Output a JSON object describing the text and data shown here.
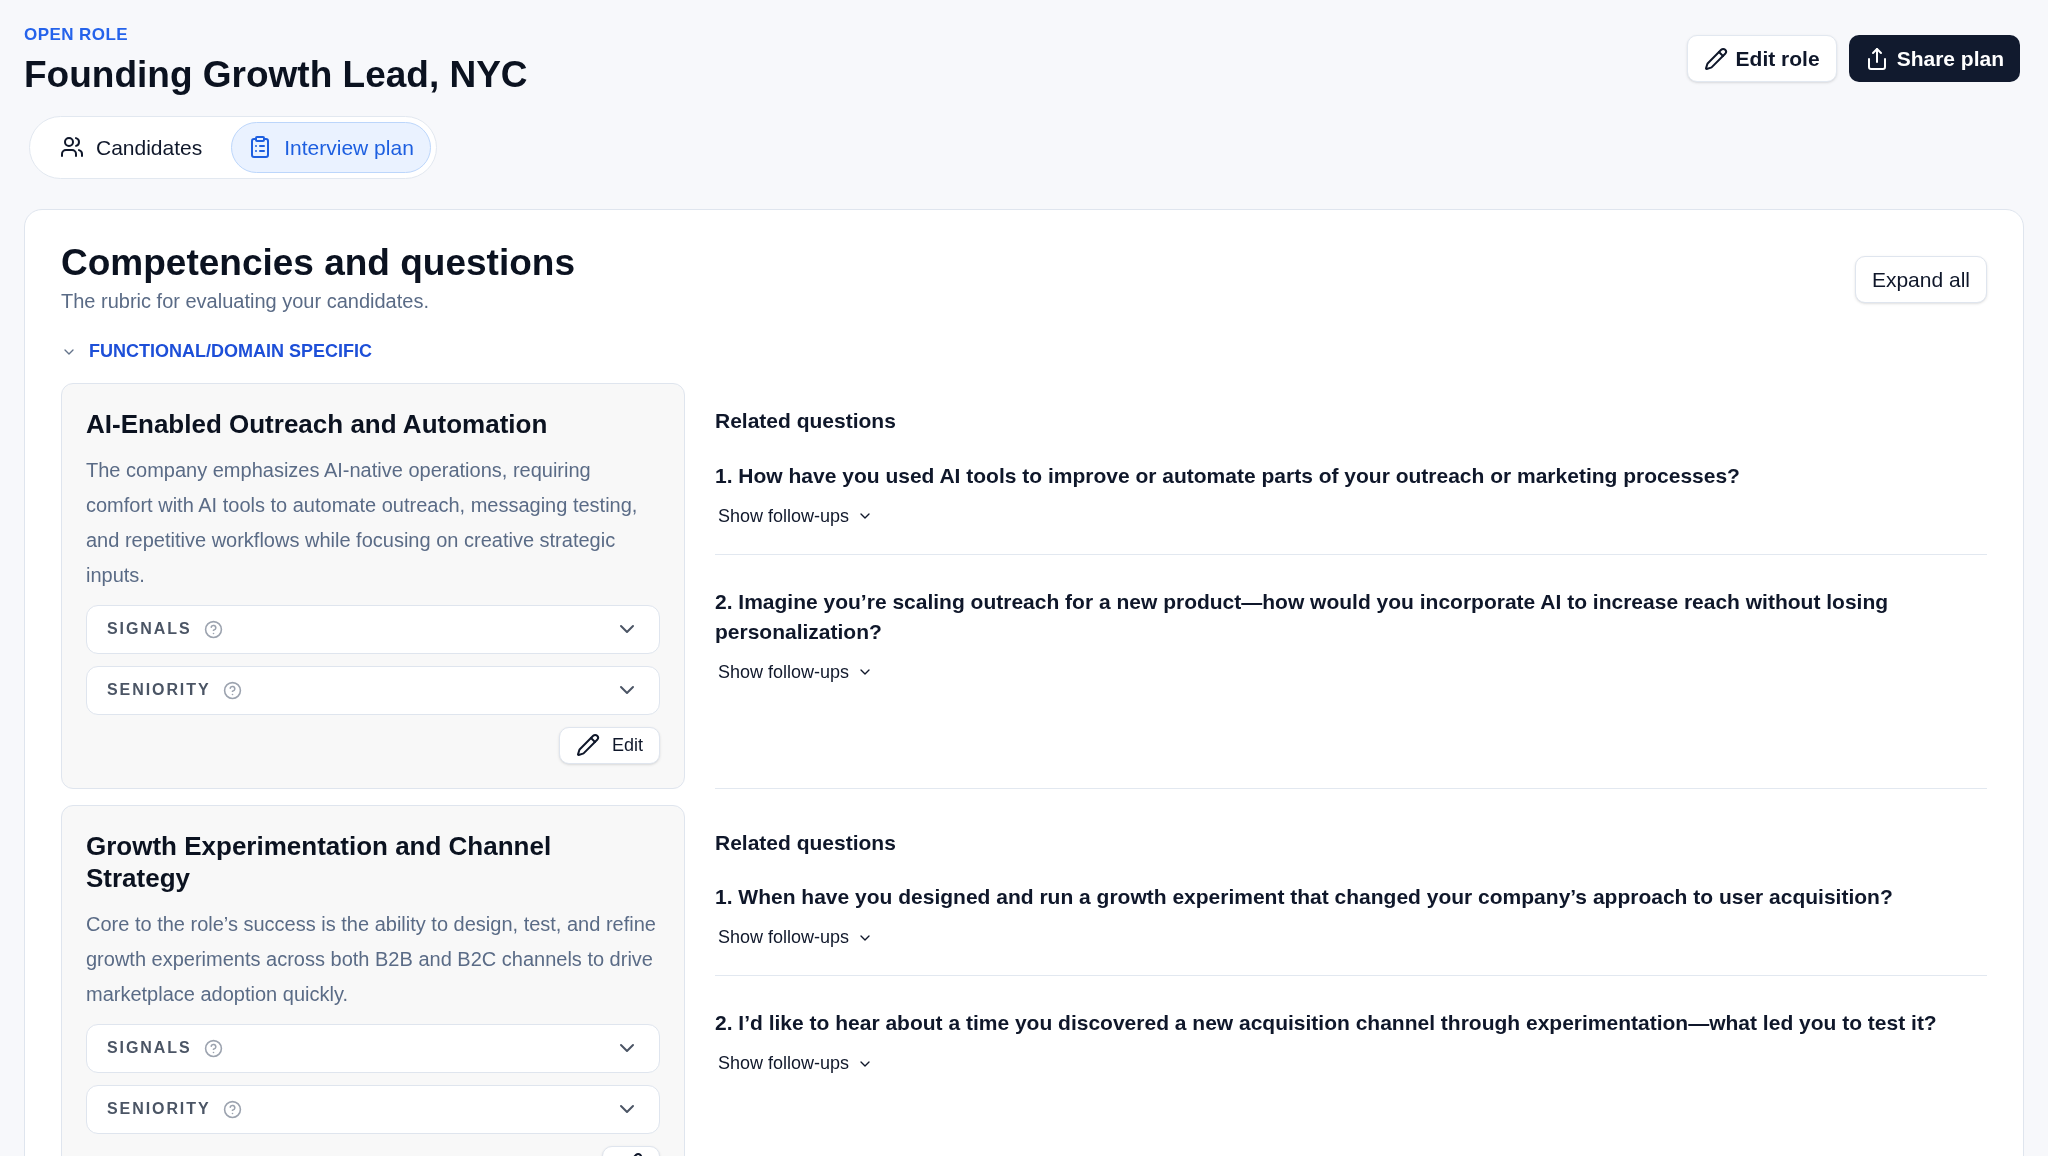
{
  "header": {
    "eyebrow": "OPEN ROLE",
    "title": "Founding Growth Lead, NYC",
    "actions": [
      {
        "kind": "edit",
        "label": "Edit role"
      },
      {
        "kind": "share",
        "label": "Share plan"
      }
    ]
  },
  "tabs": [
    {
      "kind": "people",
      "label": "Candidates",
      "selected": false
    },
    {
      "kind": "clipboard",
      "label": "Interview plan",
      "selected": true
    }
  ],
  "panel": {
    "title": "Competencies and questions",
    "subtitle": "The rubric for evaluating your candidates.",
    "expand_button": "Expand all",
    "section": {
      "label": "FUNCTIONAL/DOMAIN SPECIFIC",
      "expanded": true,
      "competencies": [
        {
          "title": "AI-Enabled Outreach and Automation",
          "description": "The company emphasizes AI-native operations, requiring comfort with AI tools to automate outreach, messaging testing, and repetitive workflows while focusing on creative strategic inputs.",
          "rubric": [
            {
              "label": "SIGNALS",
              "expanded": false
            },
            {
              "label": "SENIORITY",
              "expanded": false
            }
          ],
          "edit_label": "Edit",
          "questions_heading": "Related questions",
          "questions": [
            {
              "text": "1. How have you used AI tools to improve or automate parts of your outreach or marketing processes?",
              "follow_ups": "Show follow-ups"
            },
            {
              "text": "2. Imagine you’re scaling outreach for a new product—how would you incorporate AI to increase reach without losing personalization?",
              "follow_ups": "Show follow-ups"
            }
          ]
        },
        {
          "title": "Growth Experimentation and Channel Strategy",
          "description": "Core to the role’s success is the ability to design, test, and refine growth experiments across both B2B and B2C channels to drive marketplace adoption quickly.",
          "rubric": [
            {
              "label": "SIGNALS",
              "expanded": false
            },
            {
              "label": "SENIORITY",
              "expanded": false
            }
          ],
          "questions_heading": "Related questions",
          "questions": [
            {
              "text": "1. When have you designed and run a growth experiment that changed your company’s approach to user acquisition?",
              "follow_ups": "Show follow-ups"
            },
            {
              "text": "2. I’d like to hear about a time you discovered a new acquisition channel through experimentation—what led you to test it?",
              "follow_ups": "Show follow-ups"
            }
          ]
        }
      ]
    }
  }
}
